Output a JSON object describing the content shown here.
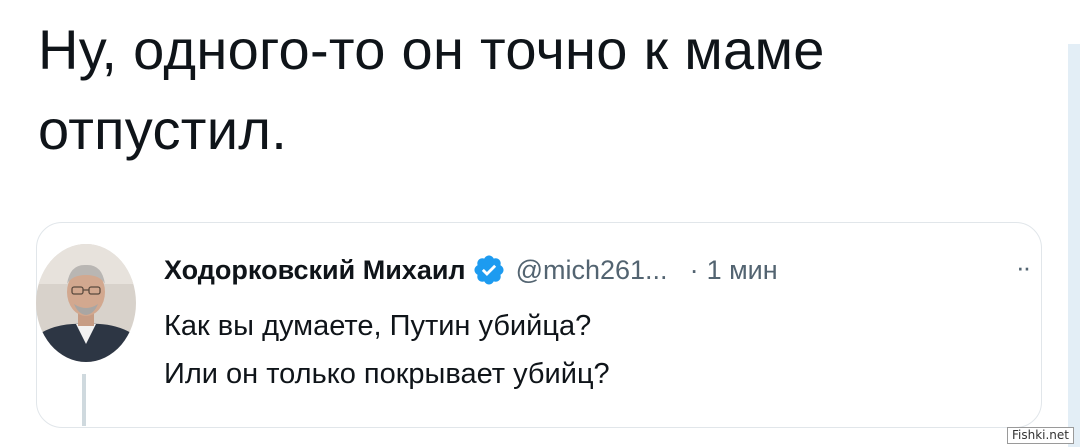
{
  "post": {
    "text": "Ну, одного-то он точно к маме отпустил."
  },
  "quoted_tweet": {
    "author_name": "Ходорковский Михаил",
    "verified": true,
    "handle": "@mich261...",
    "separator": "·",
    "time": "1 мин",
    "more_icon": "··",
    "line1": "Как вы думаете, Путин убийца?",
    "line2": "Или он только покрывает убийц?"
  },
  "watermark": {
    "text": "Fishki.net"
  },
  "colors": {
    "text": "#0f1419",
    "secondary": "#536471",
    "verified": "#1d9bf0",
    "card_border": "#e1e6ea",
    "thread_line": "#cfd9de"
  }
}
